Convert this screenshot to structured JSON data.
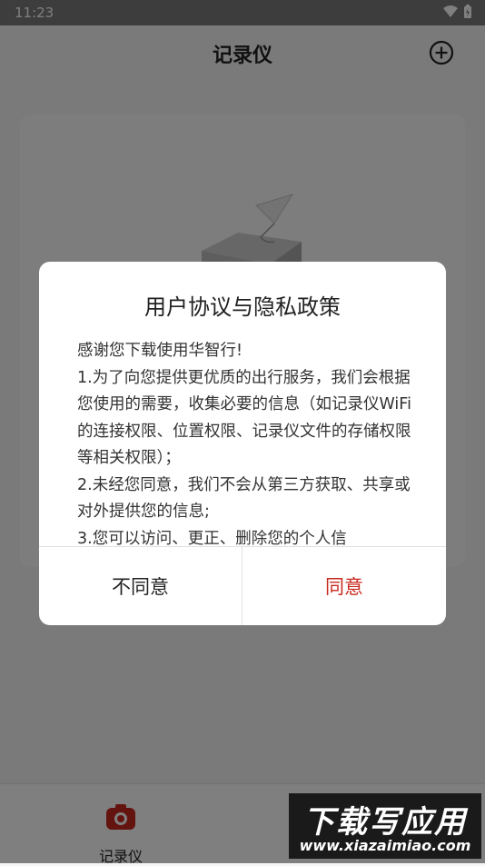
{
  "status_bar": {
    "time": "11:23"
  },
  "app_bar": {
    "title": "记录仪"
  },
  "bottom_nav": {
    "items": [
      {
        "label": "记录仪",
        "icon": "camera-icon"
      },
      {
        "label": "",
        "icon": "folder-icon"
      }
    ]
  },
  "dialog": {
    "title": "用户协议与隐私政策",
    "paragraphs": [
      "感谢您下载使用华智行!",
      "1.为了向您提供更优质的出行服务，我们会根据您使用的需要，收集必要的信息（如记录仪WiFi的连接权限、位置权限、记录仪文件的存储权限等相关权限）；",
      "2.未经您同意，我们不会从第三方获取、共享或对外提供您的信息;",
      "3.您可以访问、更正、删除您的个人信"
    ],
    "disagree_label": "不同意",
    "agree_label": "同意"
  },
  "watermark": {
    "title": "下载写应用",
    "url": "www.xiazaimiao.com"
  },
  "colors": {
    "accent": "#c8281e",
    "scrim": "rgba(0,0,0,0.5)"
  }
}
